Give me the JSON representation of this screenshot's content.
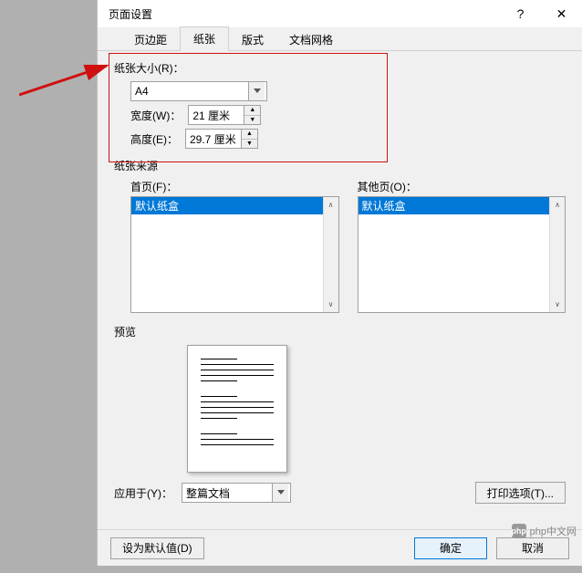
{
  "dialog": {
    "title": "页面设置",
    "help": "?",
    "close": "✕"
  },
  "tabs": {
    "margins": "页边距",
    "paper": "纸张",
    "layout": "版式",
    "grid": "文档网格"
  },
  "paper": {
    "size_group": "纸张大小(R)：",
    "size_value": "A4",
    "width_label": "宽度(W)：",
    "width_value": "21 厘米",
    "height_label": "高度(E)：",
    "height_value": "29.7 厘米"
  },
  "source": {
    "group": "纸张来源",
    "first_label": "首页(F)：",
    "other_label": "其他页(O)：",
    "first_selected": "默认纸盒",
    "other_selected": "默认纸盒"
  },
  "preview": {
    "group": "预览"
  },
  "apply": {
    "label": "应用于(Y)：",
    "value": "整篇文档",
    "print_options": "打印选项(T)..."
  },
  "footer": {
    "default": "设为默认值(D)",
    "ok": "确定",
    "cancel": "取消"
  },
  "watermark": "php中文网"
}
